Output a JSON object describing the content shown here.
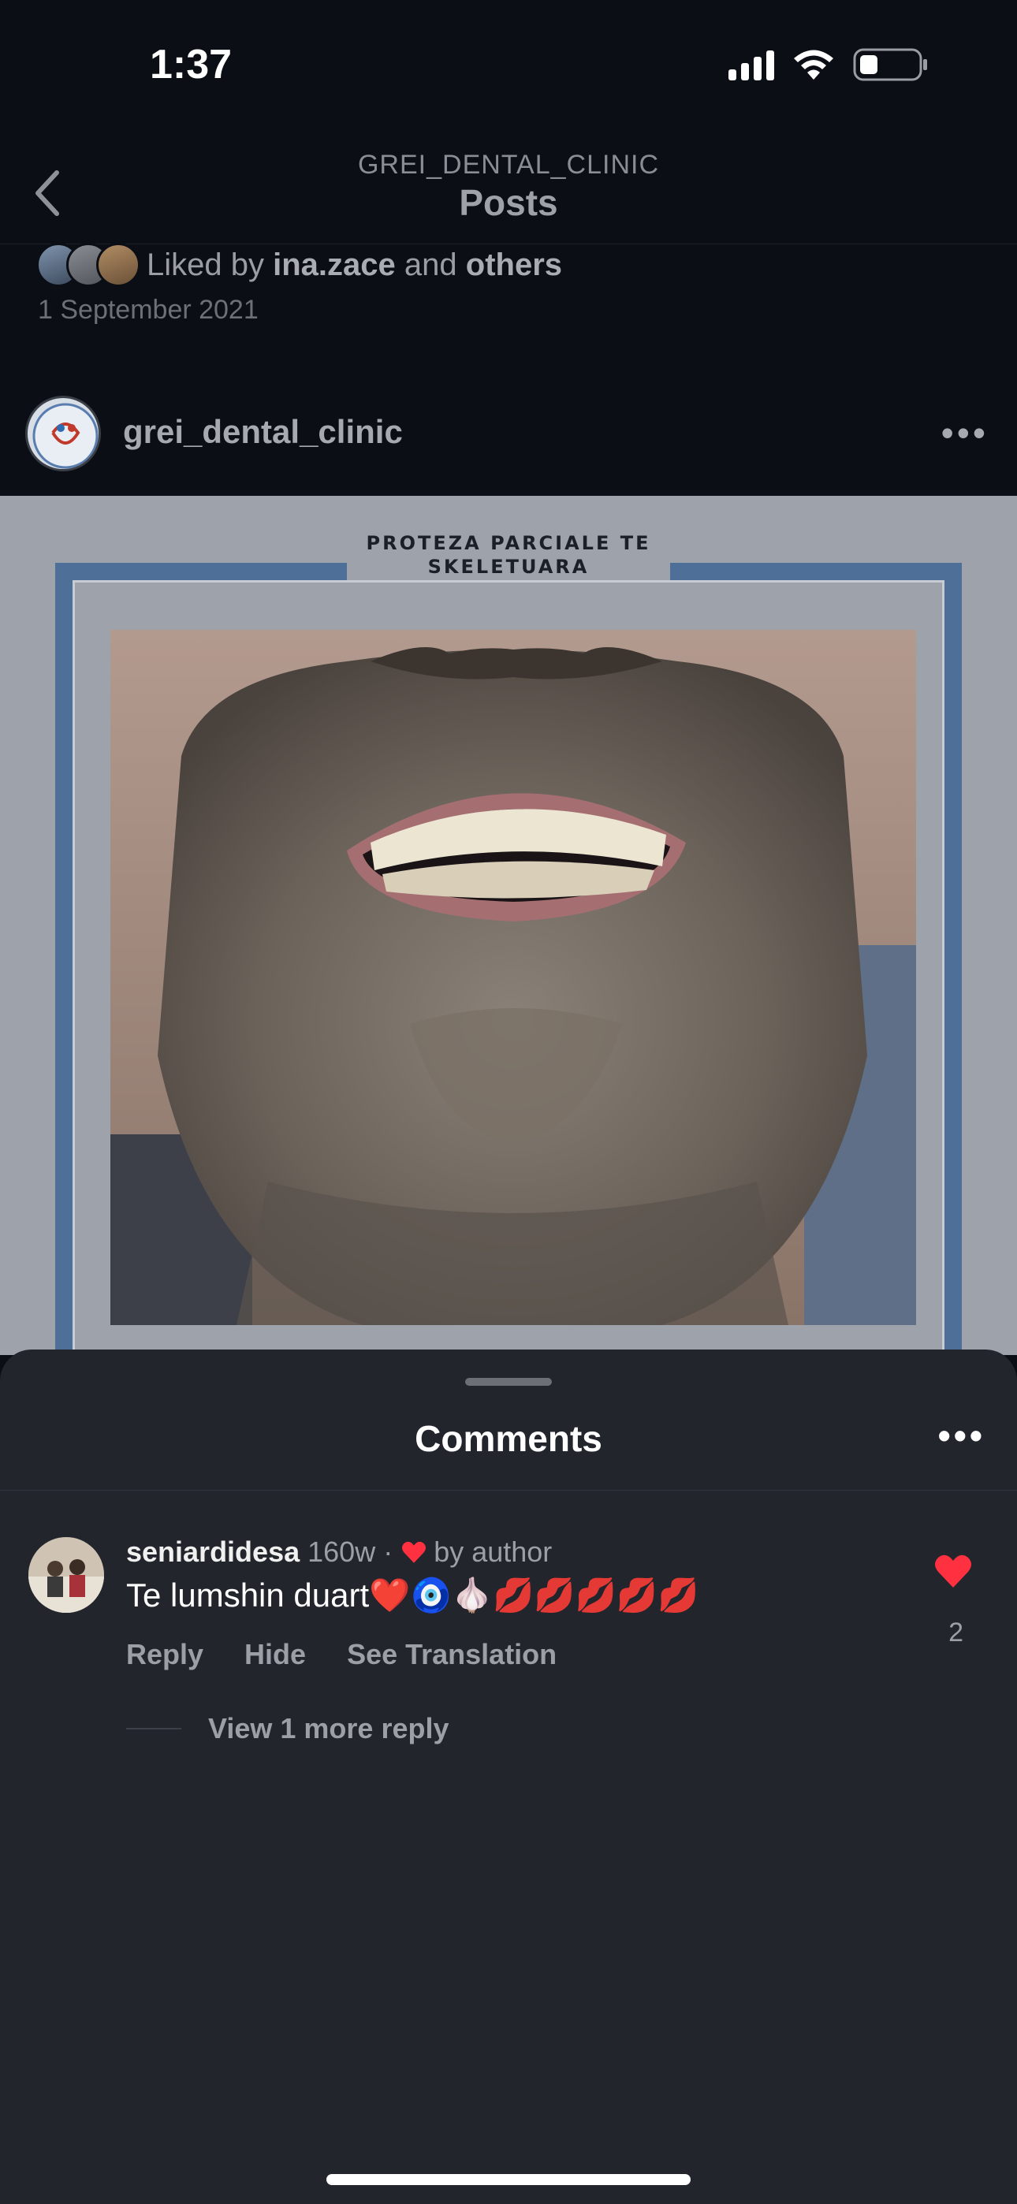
{
  "status": {
    "time": "1:37"
  },
  "nav": {
    "subtitle": "GREI_DENTAL_CLINIC",
    "title": "Posts"
  },
  "likes": {
    "prefix": "Liked by",
    "user": "ina.zace",
    "conj": "and",
    "others": "others"
  },
  "post": {
    "date": "1 September 2021",
    "username": "grei_dental_clinic",
    "more": "•••",
    "caption": "PROTEZA PARCIALE TE\nSKELETUARA"
  },
  "comments_sheet": {
    "title": "Comments",
    "more": "•••",
    "comments": [
      {
        "username": "seniardidesa",
        "time": "160w",
        "separator": "·",
        "liked_by_author": "by author",
        "text": "Te lumshin duart❤️🧿🧄💋💋💋💋💋",
        "actions": [
          "Reply",
          "Hide",
          "See Translation"
        ],
        "like_count": "2",
        "view_replies": "View 1 more reply"
      }
    ]
  },
  "colors": {
    "like_red": "#ff3040",
    "frame_blue": "#4e6f98",
    "sheet_bg": "#22252c"
  }
}
